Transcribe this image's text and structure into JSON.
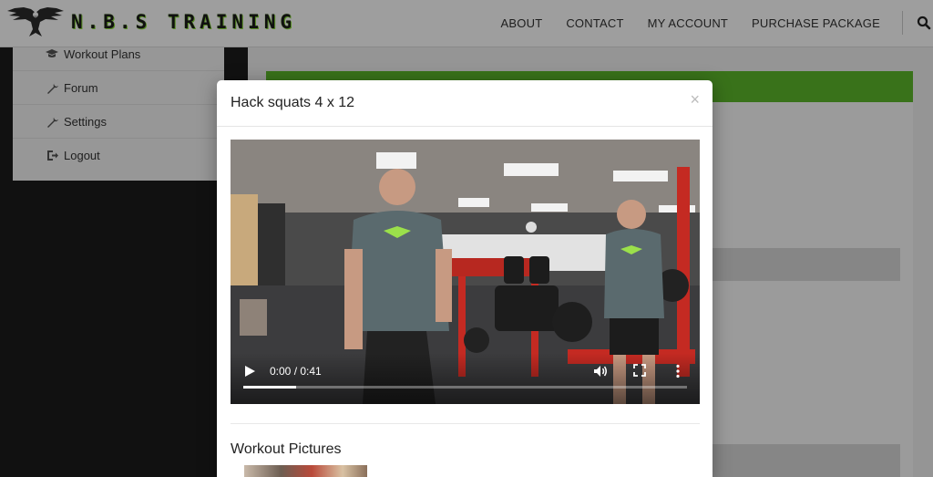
{
  "header": {
    "brand": "N.B.S TRAINING",
    "nav": [
      "ABOUT",
      "CONTACT",
      "MY ACCOUNT",
      "PURCHASE PACKAGE"
    ],
    "search_icon": "search-icon"
  },
  "sidebar": {
    "items": [
      {
        "label": "Workout Plans",
        "icon": "graduation-cap-icon"
      },
      {
        "label": "Forum",
        "icon": "wrench-icon"
      },
      {
        "label": "Settings",
        "icon": "wrench-icon"
      },
      {
        "label": "Logout",
        "icon": "logout-icon"
      }
    ]
  },
  "modal": {
    "title": "Hack squats 4 x 12",
    "close": "×",
    "video": {
      "time": "0:00 / 0:41",
      "progress": 0.12
    },
    "pictures_title": "Workout Pictures"
  },
  "colors": {
    "accent_green": "#5cb82a",
    "overlay": "rgba(0,0,0,0.38)"
  }
}
